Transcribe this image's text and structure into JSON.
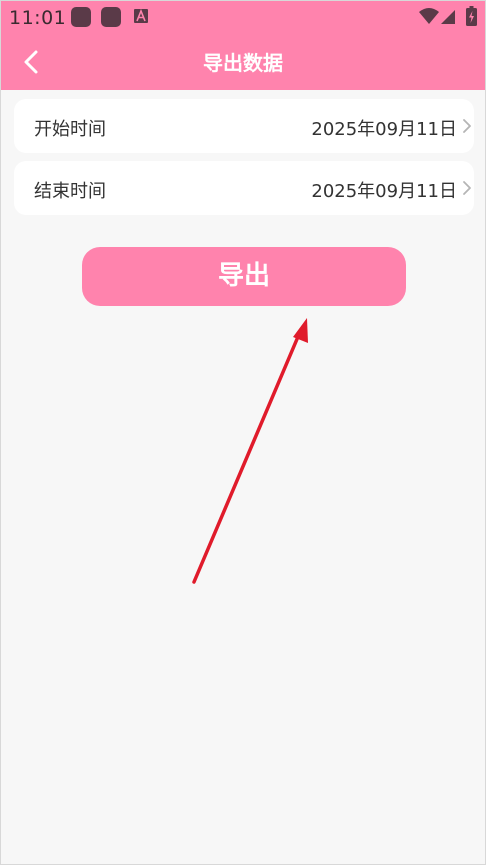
{
  "status_bar": {
    "time": "11:01",
    "icons": [
      "app-notification-icon",
      "app-notification-icon",
      "a-letter-icon",
      "wifi-icon",
      "cellular-signal-icon",
      "battery-charging-icon"
    ]
  },
  "header": {
    "title": "导出数据",
    "back_icon": "chevron-left-icon"
  },
  "form": {
    "start": {
      "label": "开始时间",
      "value": "2025年09月11日"
    },
    "end": {
      "label": "结束时间",
      "value": "2025年09月11日"
    }
  },
  "actions": {
    "export_label": "导出"
  },
  "annotation": {
    "type": "pointer-arrow",
    "color": "#e01b2b"
  },
  "colors": {
    "accent": "#ff83ad",
    "background": "#f7f7f7",
    "card": "#ffffff",
    "text": "#333333"
  }
}
